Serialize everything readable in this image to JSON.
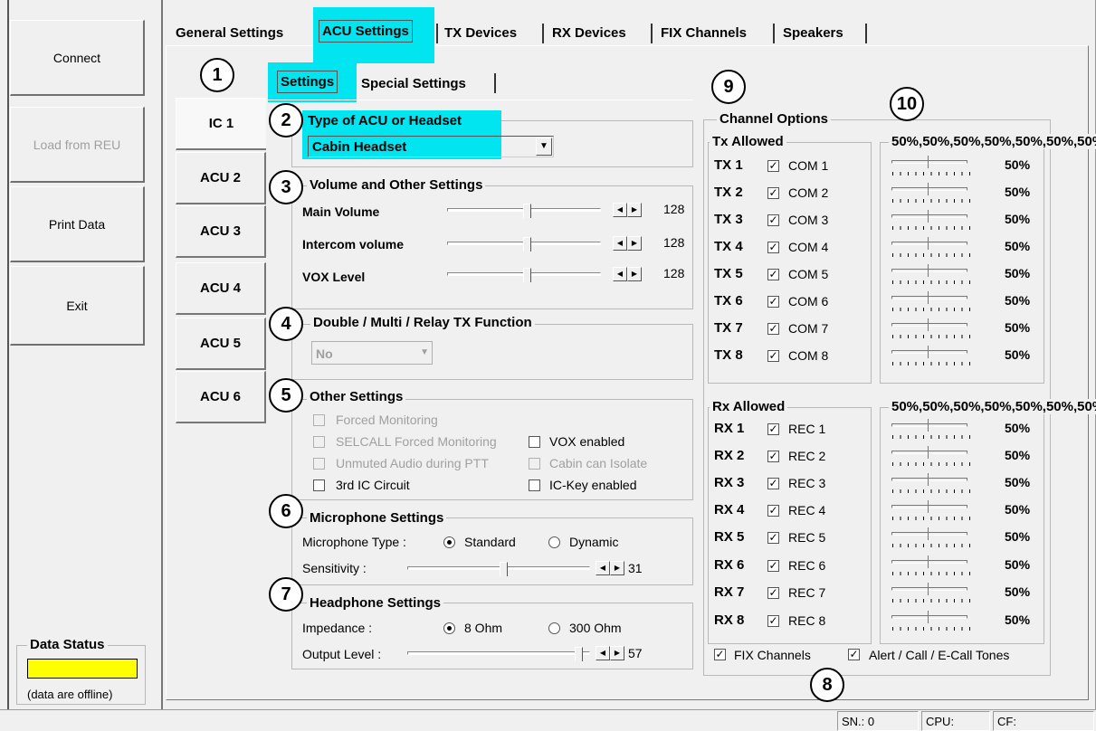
{
  "sidebar": {
    "buttons": [
      "Connect",
      "Load from REU",
      "Print Data",
      "Exit"
    ],
    "data_status_title": "Data Status",
    "data_status_text": "(data are offline)",
    "data_status_color": "#ffff00"
  },
  "main_tabs": [
    "General Settings",
    "ACU Settings",
    "TX Devices",
    "RX Devices",
    "FIX Channels",
    "Speakers"
  ],
  "sub_tabs": [
    "Settings",
    "Special Settings"
  ],
  "acu_tabs": [
    "IC 1",
    "ACU 2",
    "ACU 3",
    "ACU 4",
    "ACU 5",
    "ACU 6"
  ],
  "markers": [
    "1",
    "2",
    "3",
    "4",
    "5",
    "6",
    "7",
    "8",
    "9",
    "10"
  ],
  "type_section": {
    "title": "Type of ACU or Headset",
    "value": "Cabin Headset"
  },
  "volume_section": {
    "title": "Volume and Other Settings",
    "rows": [
      {
        "label": "Main Volume",
        "value": "128"
      },
      {
        "label": "Intercom volume",
        "value": "128"
      },
      {
        "label": "VOX Level",
        "value": "128"
      }
    ]
  },
  "tx_function": {
    "title": "Double / Multi / Relay TX Function",
    "value": "No"
  },
  "other_settings": {
    "title": "Other Settings",
    "options": [
      "Forced Monitoring",
      "SELCALL Forced Monitoring",
      "VOX enabled",
      "Unmuted Audio during PTT",
      "Cabin can Isolate",
      "3rd IC Circuit",
      "IC-Key enabled"
    ]
  },
  "mic": {
    "title": "Microphone Settings",
    "type_label": "Microphone Type :",
    "opt1": "Standard",
    "opt2": "Dynamic",
    "sens_label": "Sensitivity :",
    "sens_value": "31"
  },
  "headphone": {
    "title": "Headphone Settings",
    "imp_label": "Impedance :",
    "opt1": "8 Ohm",
    "opt2": "300 Ohm",
    "out_label": "Output Level :",
    "out_value": "57"
  },
  "channel_options": {
    "title": "Channel Options",
    "tx_allowed": "Tx Allowed",
    "tx_volumes": [
      "50%",
      "50%",
      "50%",
      "50%",
      "50%",
      "50%",
      "50%",
      "50%"
    ],
    "rx_allowed": "Rx Allowed",
    "rx_volumes": [
      "50%",
      "50%",
      "50%",
      "50%",
      "50%",
      "50%",
      "50%",
      "50%"
    ],
    "tx": [
      {
        "ch": "TX 1",
        "dev": "COM 1"
      },
      {
        "ch": "TX 2",
        "dev": "COM 2"
      },
      {
        "ch": "TX 3",
        "dev": "COM 3"
      },
      {
        "ch": "TX 4",
        "dev": "COM 4"
      },
      {
        "ch": "TX 5",
        "dev": "COM 5"
      },
      {
        "ch": "TX 6",
        "dev": "COM 6"
      },
      {
        "ch": "TX 7",
        "dev": "COM 7"
      },
      {
        "ch": "TX 8",
        "dev": "COM 8"
      }
    ],
    "rx": [
      {
        "ch": "RX 1",
        "dev": "REC 1"
      },
      {
        "ch": "RX 2",
        "dev": "REC 2"
      },
      {
        "ch": "RX 3",
        "dev": "REC 3"
      },
      {
        "ch": "RX 4",
        "dev": "REC 4"
      },
      {
        "ch": "RX 5",
        "dev": "REC 5"
      },
      {
        "ch": "RX 6",
        "dev": "REC 6"
      },
      {
        "ch": "RX 7",
        "dev": "REC 7"
      },
      {
        "ch": "RX 8",
        "dev": "REC 8"
      }
    ],
    "fix_channels": "FIX Channels",
    "alert_tones": "Alert / Call / E-Call Tones"
  },
  "statusbar": {
    "sn": "SN.: 0",
    "cpu": "CPU:",
    "cf": "CF:"
  },
  "highlight_color": "#00e5f0"
}
